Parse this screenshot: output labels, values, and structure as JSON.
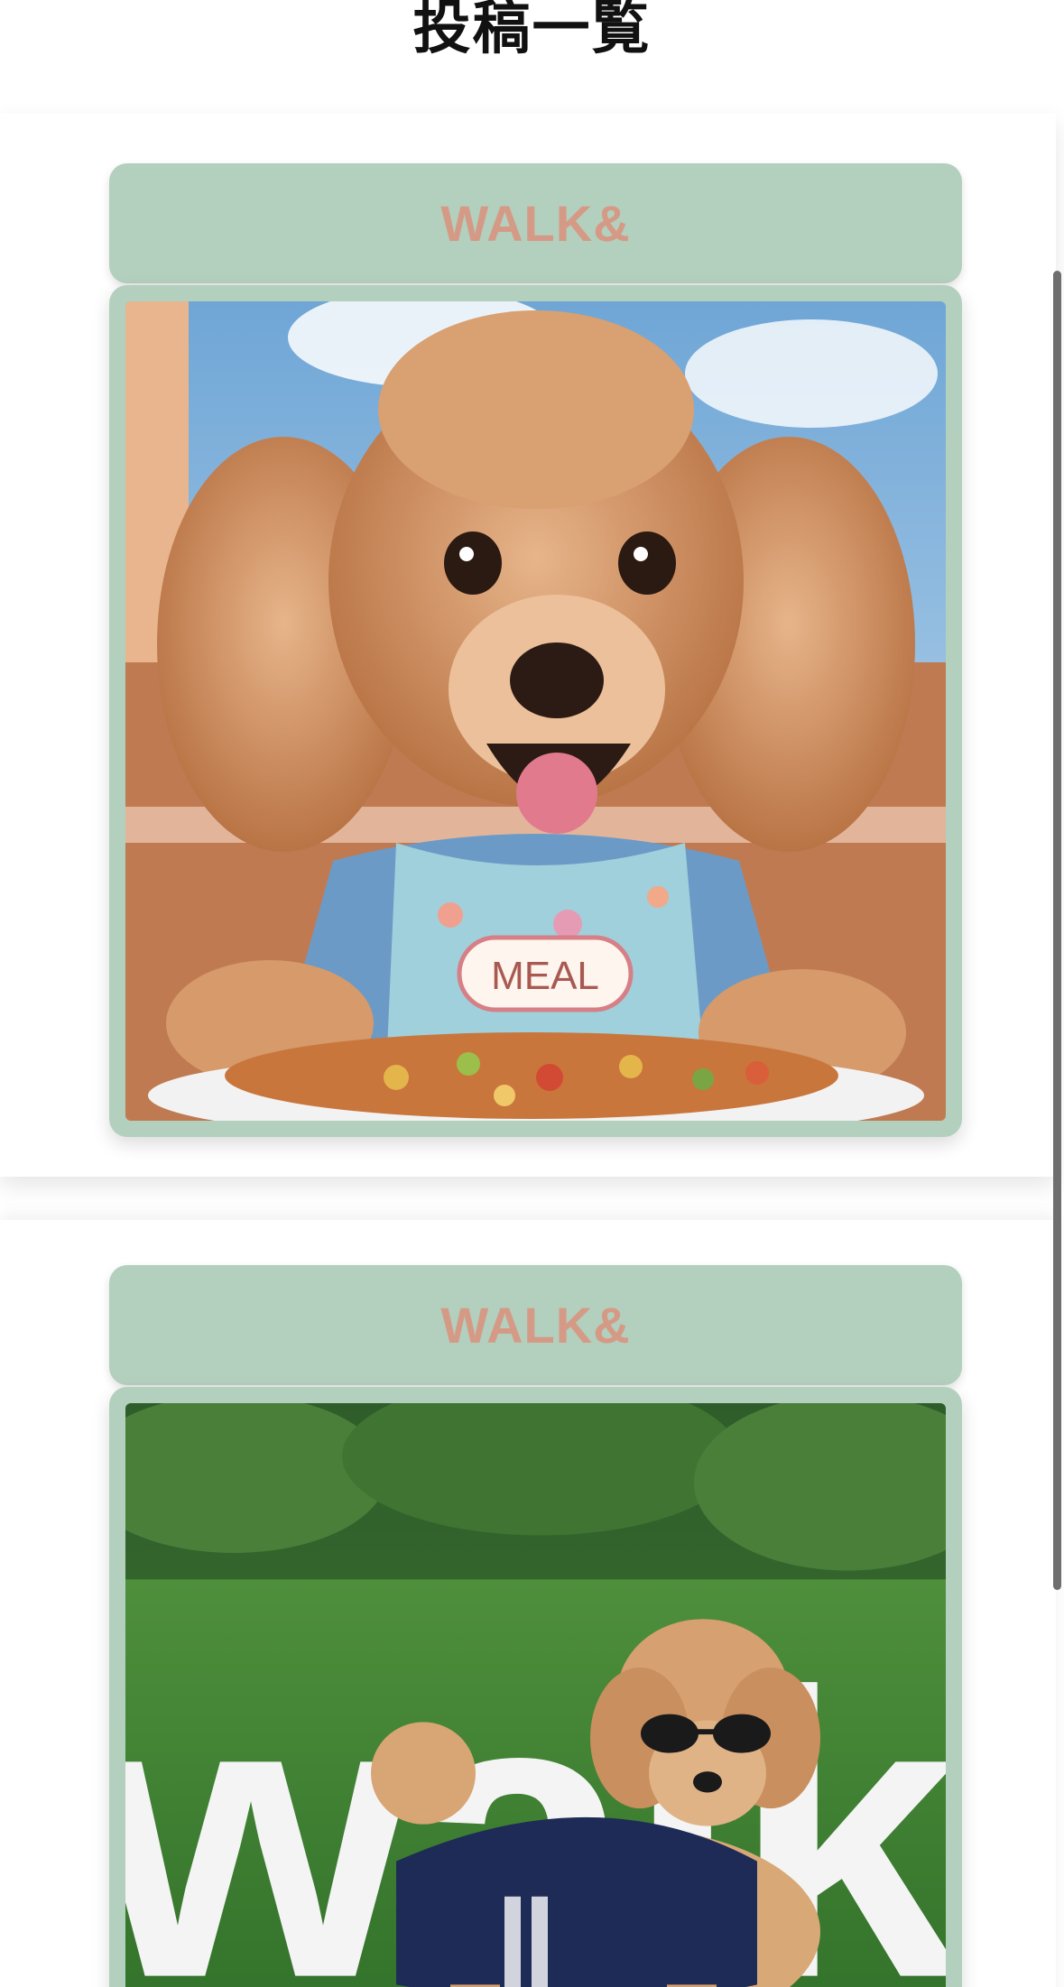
{
  "page": {
    "title": "投稿一覧"
  },
  "posts": [
    {
      "title": "WALK&",
      "photo": {
        "alt_icon": "poodle-meal-photo",
        "bib_text": "MEAL"
      }
    },
    {
      "title": "WALK&",
      "photo": {
        "alt_icon": "poodle-walk-photo",
        "sign_text": "walk"
      }
    }
  ],
  "colors": {
    "card_green": "#b3cfbd",
    "title_accent": "#d59a86",
    "scrollbar": "#6e6e6e"
  }
}
